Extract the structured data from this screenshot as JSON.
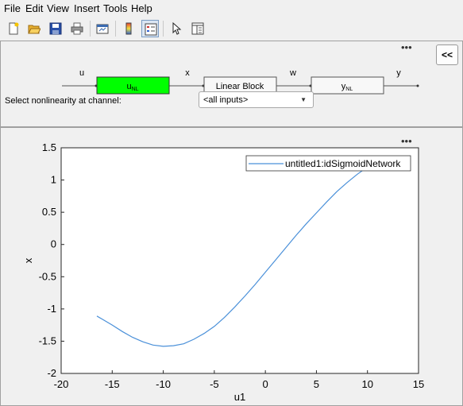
{
  "menubar": {
    "items": [
      "File",
      "Edit",
      "View",
      "Insert",
      "Tools",
      "Help"
    ]
  },
  "toolbar": {
    "buttons": [
      "new-figure-icon",
      "open-file-icon",
      "save-icon",
      "print-icon",
      "link-plot-icon",
      "colorbar-icon",
      "legend-icon",
      "pointer-icon",
      "property-editor-icon"
    ],
    "active": "legend-icon"
  },
  "block_diagram": {
    "signals": {
      "u": "u",
      "x": "x",
      "w": "w",
      "y": "y"
    },
    "input_block": {
      "main": "u",
      "sub": "NL",
      "color": "#00ff00"
    },
    "linear_block": "Linear Block",
    "output_block": {
      "main": "y",
      "sub": "NL"
    },
    "select_label": "Select nonlinearity at channel:",
    "channel_select": {
      "value": "<all inputs>"
    },
    "collapse_label": "<<",
    "more_dots": "•••"
  },
  "chart_data": {
    "type": "line",
    "xlabel": "u1",
    "ylabel": "x",
    "xlim": [
      -20,
      15
    ],
    "ylim": [
      -2,
      1.5
    ],
    "xticks": [
      "-20",
      "-15",
      "-10",
      "-5",
      "0",
      "5",
      "10",
      "15"
    ],
    "yticks": [
      "1.5",
      "1",
      "0.5",
      "0",
      "-0.5",
      "-1",
      "-1.5",
      "-2"
    ],
    "legend_position": "top-right",
    "series": [
      {
        "name": "untitled1:idSigmoidNetwork",
        "color": "#4a90d9",
        "x": [
          -16.5,
          -15,
          -14,
          -13,
          -12,
          -11,
          -10,
          -9,
          -8,
          -7,
          -6,
          -5,
          -4,
          -3,
          -2,
          -1,
          0,
          1,
          2,
          3,
          4,
          5,
          6,
          7,
          8,
          9,
          10
        ],
        "y": [
          -1.11,
          -1.25,
          -1.35,
          -1.44,
          -1.51,
          -1.56,
          -1.58,
          -1.57,
          -1.54,
          -1.47,
          -1.38,
          -1.27,
          -1.13,
          -0.97,
          -0.8,
          -0.62,
          -0.43,
          -0.24,
          -0.05,
          0.14,
          0.32,
          0.49,
          0.66,
          0.82,
          0.96,
          1.09,
          1.2
        ]
      }
    ]
  }
}
